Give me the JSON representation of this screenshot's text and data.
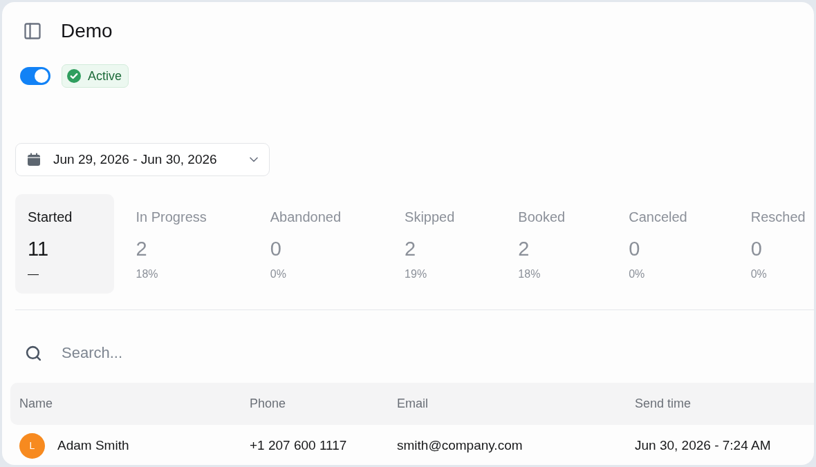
{
  "header": {
    "title": "Demo"
  },
  "status": {
    "toggle": {
      "on": true
    },
    "badge": {
      "label": "Active",
      "kind": "success"
    }
  },
  "date_range": {
    "value": "Jun 29, 2026 - Jun 30, 2026"
  },
  "stats": [
    {
      "label": "Started",
      "value": "11",
      "percent": "—",
      "selected": true
    },
    {
      "label": "In Progress",
      "value": "2",
      "percent": "18%",
      "selected": false
    },
    {
      "label": "Abandoned",
      "value": "0",
      "percent": "0%",
      "selected": false
    },
    {
      "label": "Skipped",
      "value": "2",
      "percent": "19%",
      "selected": false
    },
    {
      "label": "Booked",
      "value": "2",
      "percent": "18%",
      "selected": false
    },
    {
      "label": "Canceled",
      "value": "0",
      "percent": "0%",
      "selected": false
    },
    {
      "label": "Resched",
      "value": "0",
      "percent": "0%",
      "selected": false
    }
  ],
  "search": {
    "placeholder": "Search..."
  },
  "table": {
    "columns": [
      "Name",
      "Phone",
      "Email",
      "Send time"
    ],
    "rows": [
      {
        "avatar": {
          "initial": "L",
          "color": "#f78a1f"
        },
        "name": "Adam Smith",
        "phone": "+1 207 600 1117",
        "email": "smith@company.com",
        "send_time": "Jun 30, 2026 - 7:24 AM"
      }
    ]
  }
}
